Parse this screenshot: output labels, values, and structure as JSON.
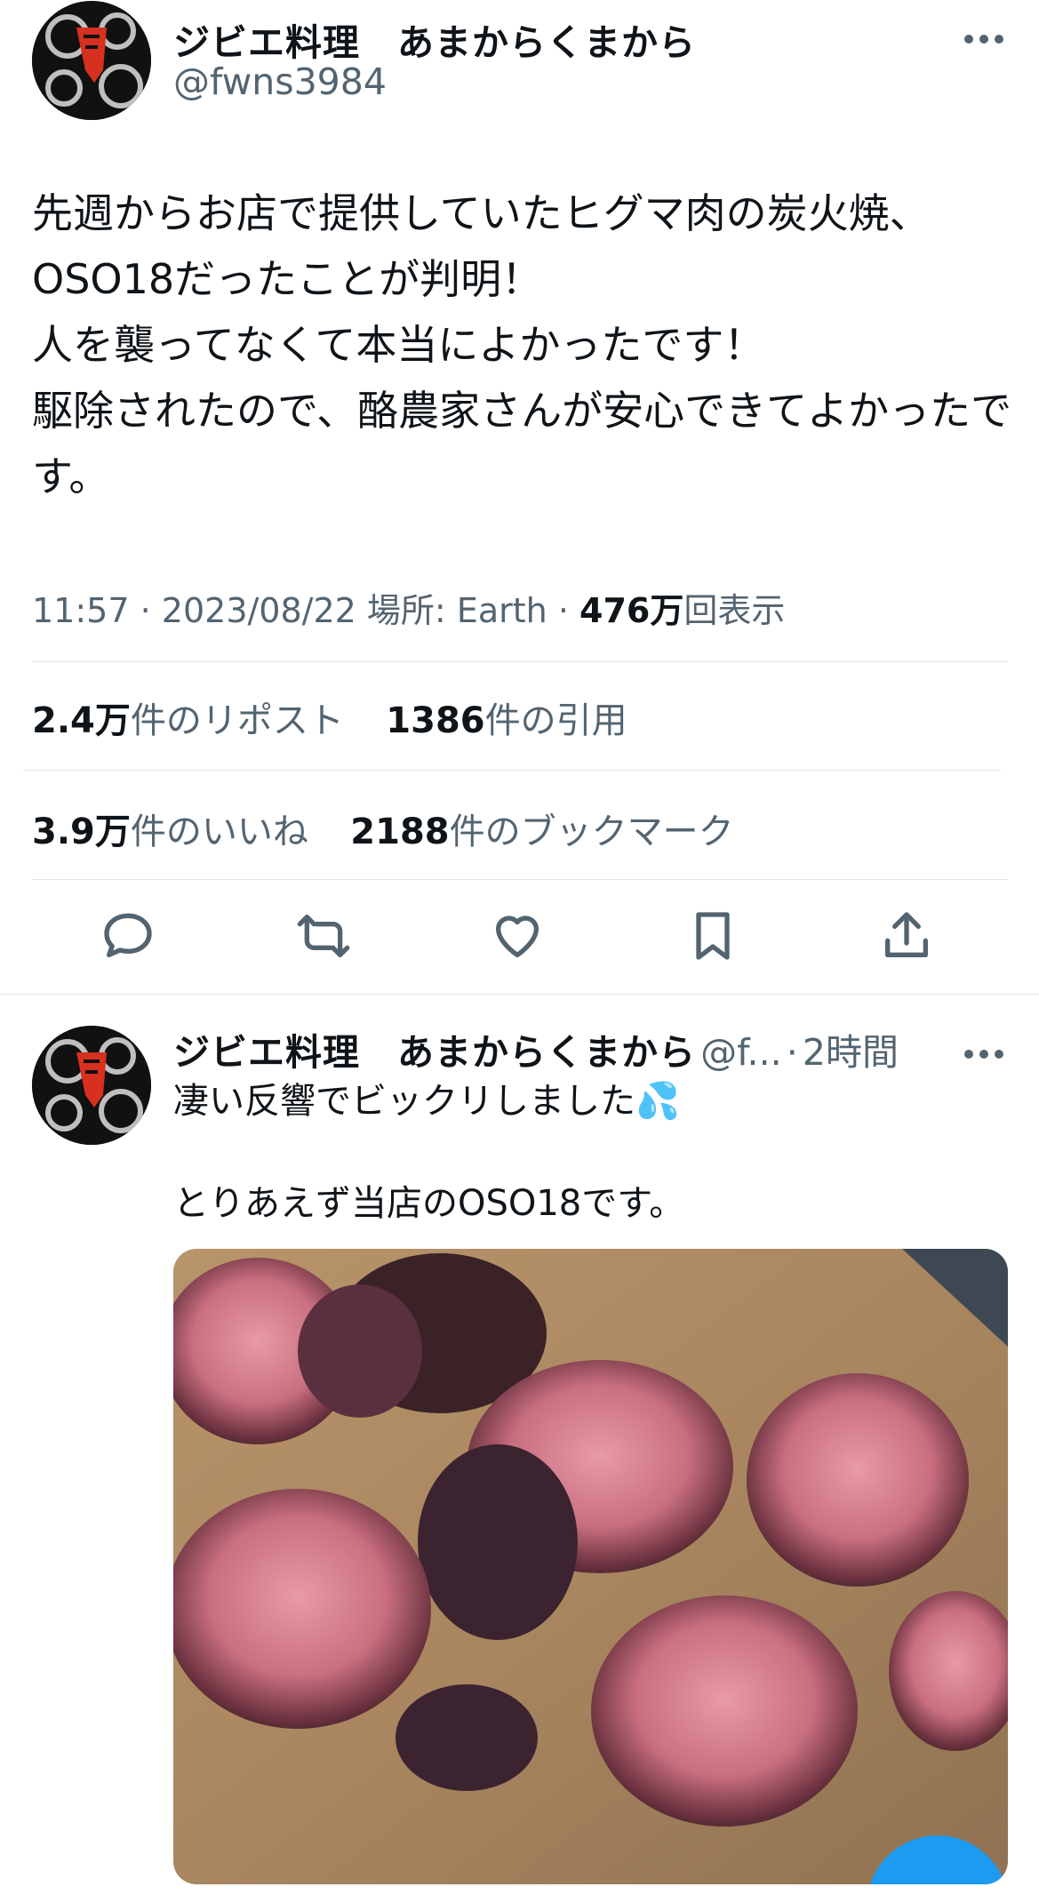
{
  "main_tweet": {
    "author_name": "ジビエ料理　あまからくまから",
    "author_handle": "@fwns3984",
    "more_icon": "more-horizontal-icon",
    "text": "先週からお店で提供していたヒグマ肉の炭火焼、\nOSO18だったことが判明！\n人を襲ってなくて本当によかったです！\n駆除されたので、酪農家さんが安心できてよかったです。",
    "time": "11:57",
    "date": "2023/08/22",
    "location": "場所: Earth",
    "views_count": "476万",
    "views_label": "回表示",
    "sep": "·"
  },
  "stats": {
    "reposts_count": "2.4万",
    "reposts_label": "件のリポスト",
    "quotes_count": "1386",
    "quotes_label": "件の引用",
    "likes_count": "3.9万",
    "likes_label": "件のいいね",
    "bookmarks_count": "2188",
    "bookmarks_label": "件のブックマーク"
  },
  "actions": [
    "reply-icon",
    "repost-icon",
    "like-icon",
    "bookmark-icon",
    "share-icon"
  ],
  "reply_tweet": {
    "author_name": "ジビエ料理　あまからくまから",
    "author_handle": "@f...",
    "sep": "·",
    "time_ago": "2時間",
    "text_line1": "凄い反響でビックリしました",
    "emoji": "💦",
    "text_line2": "とりあえず当店のOSO18です。",
    "image_icon": "grilled-bear-meat-photo"
  },
  "colors": {
    "secondary_text": "#536471",
    "primary_text": "#0f1419",
    "divider": "#e1e4e8",
    "accent_blue": "#1d9bf0"
  }
}
